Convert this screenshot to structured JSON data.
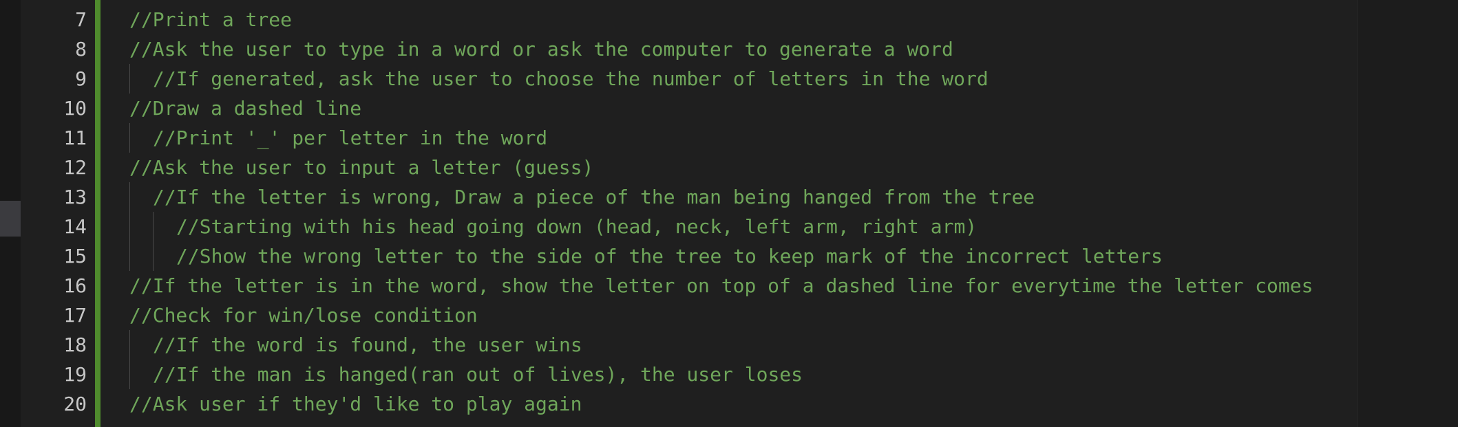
{
  "lines": [
    {
      "number": "7",
      "indent": 0,
      "text": "//Print a tree"
    },
    {
      "number": "8",
      "indent": 0,
      "text": "//Ask the user to type in a word or ask the computer to generate a word"
    },
    {
      "number": "9",
      "indent": 1,
      "text": "//If generated, ask the user to choose the number of letters in the word"
    },
    {
      "number": "10",
      "indent": 0,
      "text": "//Draw a dashed line"
    },
    {
      "number": "11",
      "indent": 1,
      "text": "//Print '_' per letter in the word"
    },
    {
      "number": "12",
      "indent": 0,
      "text": "//Ask the user to input a letter (guess)"
    },
    {
      "number": "13",
      "indent": 1,
      "text": "//If the letter is wrong, Draw a piece of the man being hanged from the tree"
    },
    {
      "number": "14",
      "indent": 2,
      "text": "//Starting with his head going down (head, neck, left arm, right arm)"
    },
    {
      "number": "15",
      "indent": 2,
      "text": "//Show the wrong letter to the side of the tree to keep mark of the incorrect letters"
    },
    {
      "number": "16",
      "indent": 0,
      "text": "//If the letter is in the word, show the letter on top of a dashed line for everytime the letter comes"
    },
    {
      "number": "17",
      "indent": 0,
      "text": "//Check for win/lose condition"
    },
    {
      "number": "18",
      "indent": 1,
      "text": "//If the word is found, the user wins"
    },
    {
      "number": "19",
      "indent": 1,
      "text": "//If the man is hanged(ran out of lives), the user loses"
    },
    {
      "number": "20",
      "indent": 0,
      "text": "//Ask user if they'd like to play again"
    }
  ],
  "colors": {
    "background": "#1f1f1f",
    "comment": "#6fa65a",
    "line_number": "#c7c7c7",
    "git_added_bar": "#4f8b2d"
  }
}
